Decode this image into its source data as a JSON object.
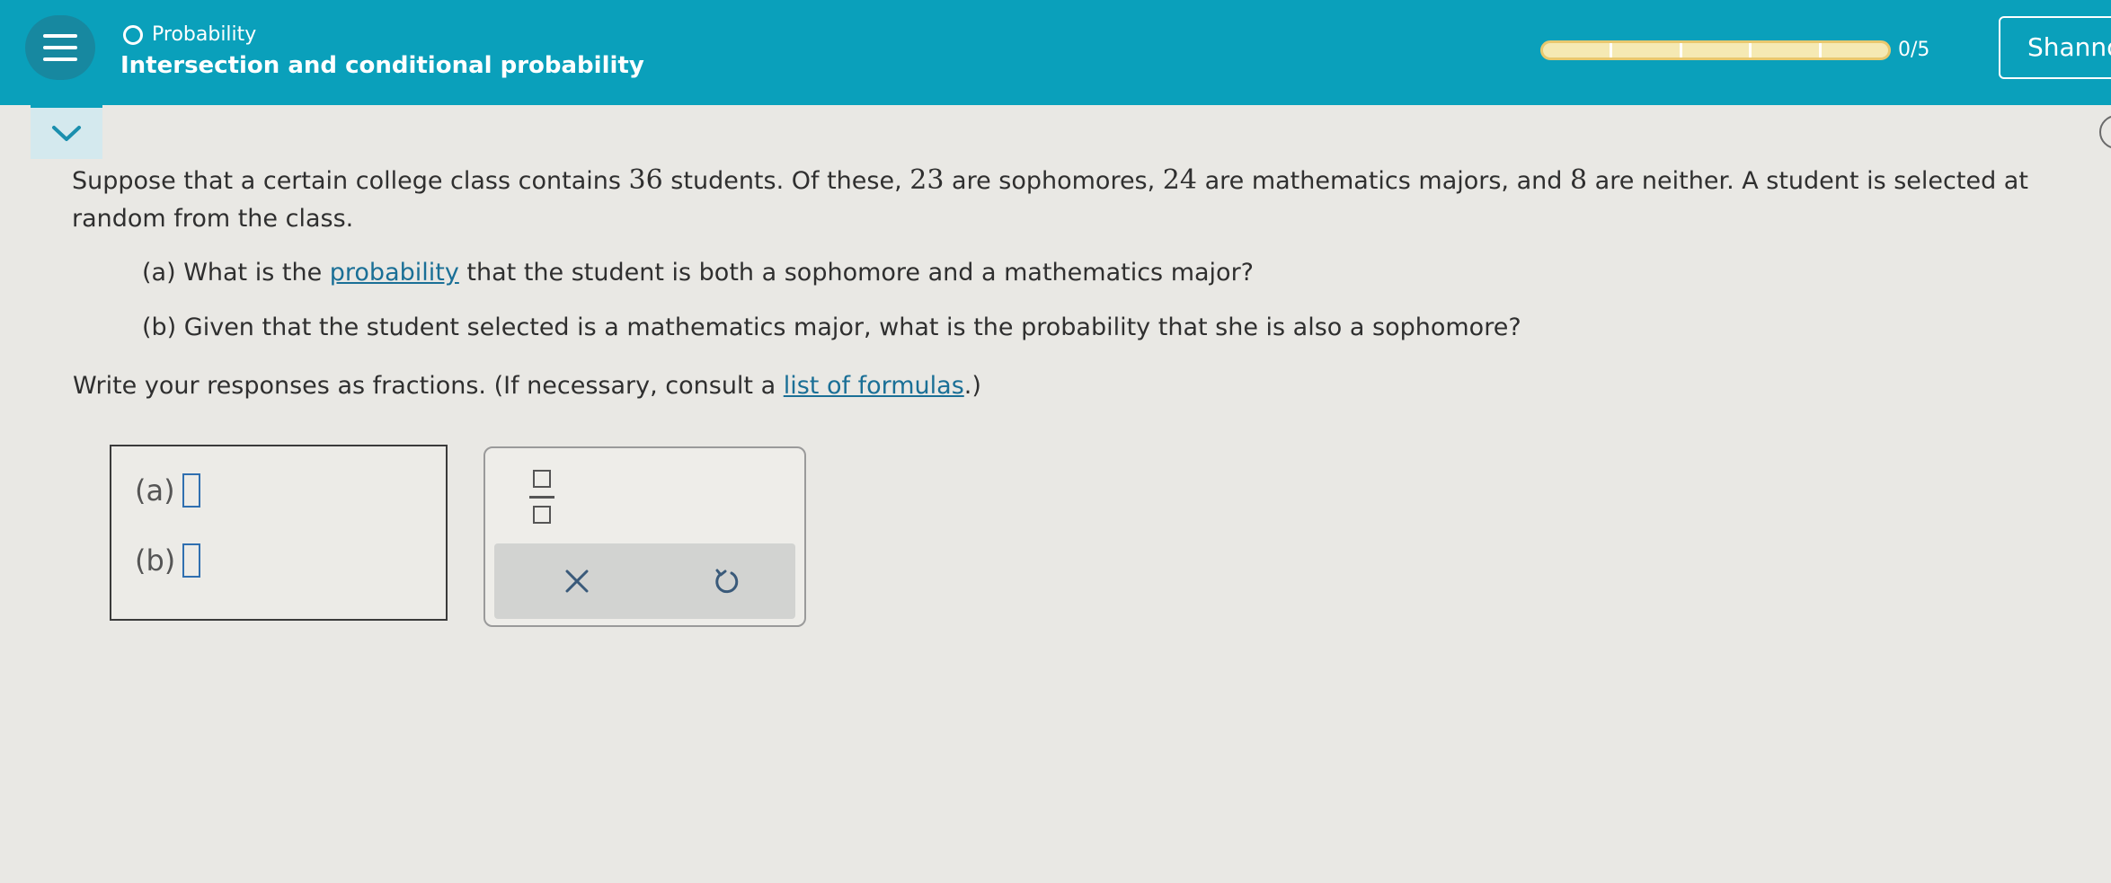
{
  "header": {
    "topic": "Probability",
    "lesson_title": "Intersection and conditional probability",
    "progress_value": 0.0,
    "score": "0/5",
    "user_name": "Shannon"
  },
  "question": {
    "p1_text1": "Suppose that a certain college class contains ",
    "n_total": "36",
    "p1_text2": " students. Of these, ",
    "n_soph": "23",
    "p1_text3": " are sophomores, ",
    "n_math": "24",
    "p1_text4": " are mathematics majors, and ",
    "n_neither": "8",
    "p1_text5": " are neither. A student is selected at random from the class.",
    "part_a_prefix": "(a) What is the ",
    "part_a_link": "probability",
    "part_a_suffix": " that the student is both a sophomore and a mathematics major?",
    "part_b": "(b) Given that the student selected is a mathematics major, what is the probability that she is also a sophomore?",
    "instruction_prefix": "Write your responses as fractions. (If necessary, consult a ",
    "instruction_link": "list of formulas",
    "instruction_suffix": ".)"
  },
  "answers": {
    "a_label": "(a)",
    "b_label": "(b)",
    "a_value": "",
    "b_value": ""
  },
  "tools": {
    "fraction_icon": "fraction-icon",
    "clear_icon": "close-icon",
    "undo_icon": "undo-icon"
  },
  "colors": {
    "header_bg": "#0aa0bb",
    "menu_bg": "#1788a0",
    "progress_fill": "#f5e9b3",
    "progress_border": "#e9c86e",
    "link": "#1a6f96",
    "answer_blank": "#2f6fb0"
  }
}
